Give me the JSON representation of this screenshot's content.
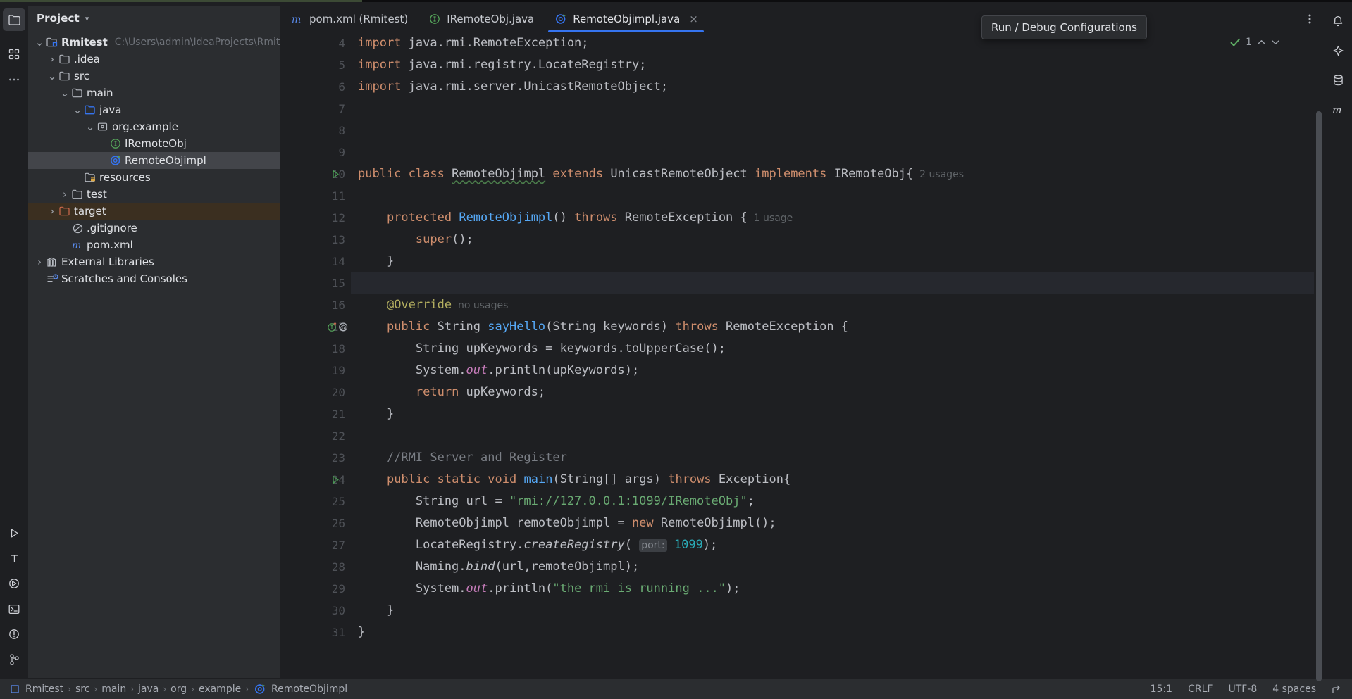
{
  "sidebar": {
    "title": "Project",
    "tree": [
      {
        "depth": 0,
        "twisty": "down",
        "icon": "module-icon",
        "label": "Rmitest",
        "bold": true,
        "path": "C:\\Users\\admin\\IdeaProjects\\Rmitest",
        "state": "normal"
      },
      {
        "depth": 1,
        "twisty": "right",
        "icon": "folder-icon",
        "label": ".idea",
        "state": "normal"
      },
      {
        "depth": 1,
        "twisty": "down",
        "icon": "folder-icon",
        "label": "src",
        "state": "normal"
      },
      {
        "depth": 2,
        "twisty": "down",
        "icon": "folder-icon",
        "label": "main",
        "state": "normal"
      },
      {
        "depth": 3,
        "twisty": "down",
        "icon": "source-root-icon",
        "label": "java",
        "state": "normal"
      },
      {
        "depth": 4,
        "twisty": "down",
        "icon": "package-icon",
        "label": "org.example",
        "state": "normal"
      },
      {
        "depth": 5,
        "twisty": "none",
        "icon": "interface-icon",
        "label": "IRemoteObj",
        "state": "normal"
      },
      {
        "depth": 5,
        "twisty": "none",
        "icon": "class-run-icon",
        "label": "RemoteObjimpl",
        "state": "selected"
      },
      {
        "depth": 3,
        "twisty": "none",
        "icon": "resources-root-icon",
        "label": "resources",
        "state": "normal"
      },
      {
        "depth": 2,
        "twisty": "right",
        "icon": "folder-icon",
        "label": "test",
        "state": "normal"
      },
      {
        "depth": 1,
        "twisty": "right",
        "icon": "folder-excluded-icon",
        "label": "target",
        "state": "excluded"
      },
      {
        "depth": 2,
        "twisty": "none",
        "icon": "gitignore-icon",
        "label": ".gitignore",
        "state": "normal"
      },
      {
        "depth": 2,
        "twisty": "none",
        "icon": "maven-icon",
        "label": "pom.xml",
        "state": "normal"
      },
      {
        "depth": 0,
        "twisty": "right",
        "icon": "library-icon",
        "label": "External Libraries",
        "state": "normal"
      },
      {
        "depth": 0,
        "twisty": "none",
        "icon": "scratches-icon",
        "label": "Scratches and Consoles",
        "state": "normal"
      }
    ]
  },
  "tabs": [
    {
      "icon": "maven-icon",
      "label": "pom.xml (Rmitest)",
      "active": false,
      "closable": false
    },
    {
      "icon": "interface-icon",
      "label": "IRemoteObj.java",
      "active": false,
      "closable": false
    },
    {
      "icon": "class-run-icon",
      "label": "RemoteObjimpl.java",
      "active": true,
      "closable": true
    }
  ],
  "tooltip": {
    "text": "Run / Debug Configurations"
  },
  "inspections": {
    "ok_count": "1"
  },
  "editor": {
    "lines": [
      {
        "n": "4",
        "marker": "none",
        "current": false
      },
      {
        "n": "5",
        "marker": "none",
        "current": false
      },
      {
        "n": "6",
        "marker": "none",
        "current": false
      },
      {
        "n": "7",
        "marker": "none",
        "current": false
      },
      {
        "n": "8",
        "marker": "none",
        "current": false
      },
      {
        "n": "9",
        "marker": "none",
        "current": false
      },
      {
        "n": "10",
        "marker": "run",
        "current": false
      },
      {
        "n": "11",
        "marker": "none",
        "current": false
      },
      {
        "n": "12",
        "marker": "none",
        "current": false
      },
      {
        "n": "13",
        "marker": "none",
        "current": false
      },
      {
        "n": "14",
        "marker": "none",
        "current": false
      },
      {
        "n": "15",
        "marker": "none",
        "current": true
      },
      {
        "n": "16",
        "marker": "none",
        "current": false
      },
      {
        "n": "17",
        "marker": "override",
        "current": false
      },
      {
        "n": "18",
        "marker": "none",
        "current": false
      },
      {
        "n": "19",
        "marker": "none",
        "current": false
      },
      {
        "n": "20",
        "marker": "none",
        "current": false
      },
      {
        "n": "21",
        "marker": "none",
        "current": false
      },
      {
        "n": "22",
        "marker": "none",
        "current": false
      },
      {
        "n": "23",
        "marker": "none",
        "current": false
      },
      {
        "n": "24",
        "marker": "run",
        "current": false
      },
      {
        "n": "25",
        "marker": "none",
        "current": false
      },
      {
        "n": "26",
        "marker": "none",
        "current": false
      },
      {
        "n": "27",
        "marker": "none",
        "current": false
      },
      {
        "n": "28",
        "marker": "none",
        "current": false
      },
      {
        "n": "29",
        "marker": "none",
        "current": false
      },
      {
        "n": "30",
        "marker": "none",
        "current": false
      },
      {
        "n": "31",
        "marker": "none",
        "current": false
      }
    ],
    "code_text": [
      "import java.rmi.RemoteException;",
      "import java.rmi.registry.LocateRegistry;",
      "import java.rmi.server.UnicastRemoteObject;",
      "",
      "",
      "",
      "public class RemoteObjimpl extends UnicastRemoteObject implements IRemoteObj{  2 usages",
      "",
      "    protected RemoteObjimpl() throws RemoteException {  1 usage",
      "        super();",
      "    }",
      "",
      "    @Override  no usages",
      "    public String sayHello(String keywords) throws RemoteException {",
      "        String upKeywords = keywords.toUpperCase();",
      "        System.out.println(upKeywords);",
      "        return upKeywords;",
      "    }",
      "",
      "    //RMI Server and Register",
      "    public static void main(String[] args) throws Exception{",
      "        String url = \"rmi://127.0.0.1:1099/IRemoteObj\";",
      "        RemoteObjimpl remoteObjimpl = new RemoteObjimpl();",
      "        LocateRegistry.createRegistry( port: 1099);",
      "        Naming.bind(url,remoteObjimpl);",
      "        System.out.println(\"the rmi is running ...\");",
      "    }",
      "}"
    ],
    "hints": {
      "class_usages": "2 usages",
      "ctor_usages": "1 usage",
      "override_usages": "no usages",
      "port_param": "port:"
    }
  },
  "status": {
    "breadcrumbs": [
      "Rmitest",
      "src",
      "main",
      "java",
      "org",
      "example",
      "RemoteObjimpl"
    ],
    "breadcrumb_icon": "module-icon",
    "breadcrumb_last_icon": "class-run-icon",
    "caret": "15:1",
    "line_separator": "CRLF",
    "encoding": "UTF-8",
    "indent": "4 spaces"
  },
  "colors": {
    "accent": "#3574f0",
    "background": "#1e1f22",
    "panel": "#2b2d30",
    "selection": "#43454a",
    "excluded": "#3b2f20",
    "keyword": "#cf8e6d",
    "string": "#6aab73",
    "number": "#2aacb8",
    "method": "#56a8f5",
    "comment": "#7a7e85",
    "annotation": "#b3ae60",
    "static_field": "#c77dbb"
  }
}
